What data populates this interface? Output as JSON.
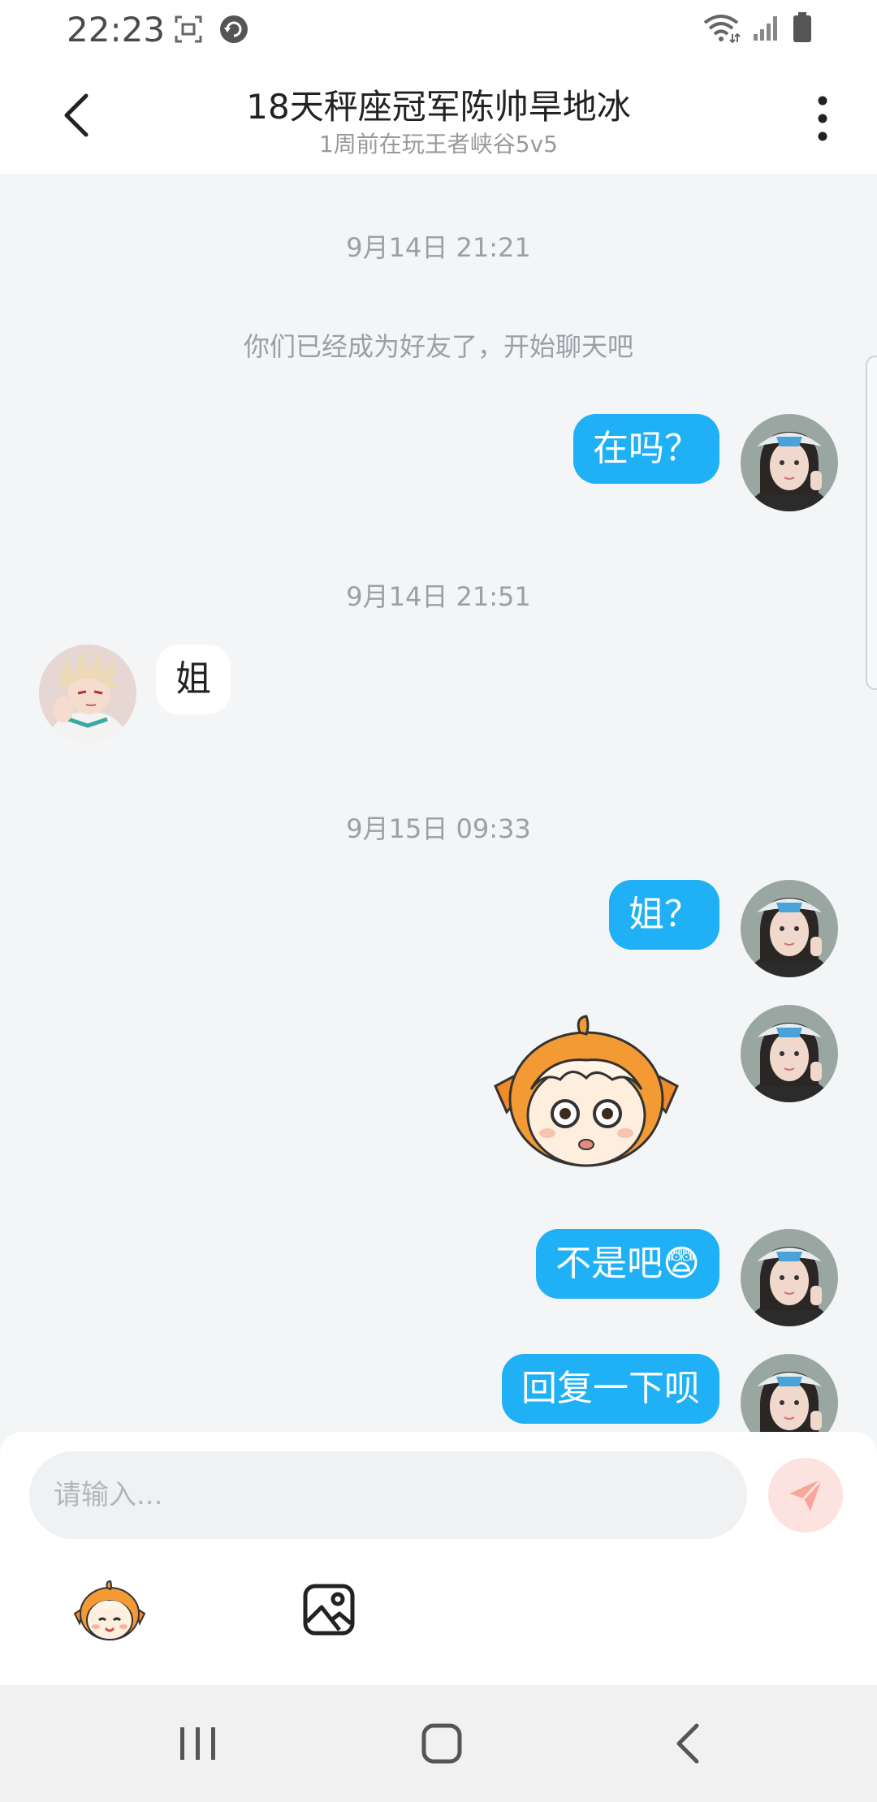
{
  "status_bar": {
    "time": "22:23",
    "icons": [
      "screenshot-icon",
      "sync-icon",
      "wifi-icon",
      "signal-icon",
      "battery-icon"
    ]
  },
  "header": {
    "title": "18天秤座冠军陈帅旱地冰",
    "subtitle": "1周前在玩王者峡谷5v5",
    "icons": [
      "back-arrow-icon",
      "more-vertical-icon"
    ]
  },
  "chat": {
    "timestamp_1": "9月14日 21:21",
    "system_message": "你们已经成为好友了，开始聊天吧",
    "msg_1": "在吗？",
    "timestamp_2": "9月14日 21:51",
    "msg_2": "姐",
    "timestamp_3": "9月15日 09:33",
    "msg_3": "姐？",
    "msg_4_sticker": "surprised-mascot-sticker",
    "msg_5": "不是吧😨",
    "msg_6": "回复一下呗"
  },
  "input": {
    "placeholder": "请输入..."
  },
  "toolbar": {
    "icons": [
      "emoji-mascot-icon",
      "image-icon",
      "send-icon"
    ]
  },
  "navigation": {
    "icons": [
      "recent-apps-icon",
      "home-icon",
      "back-icon"
    ]
  },
  "colors": {
    "accent_blue": "#1fb0f5",
    "background": "#f3f5f7",
    "send_button": "#fde3df",
    "send_icon": "#f7a69b"
  }
}
